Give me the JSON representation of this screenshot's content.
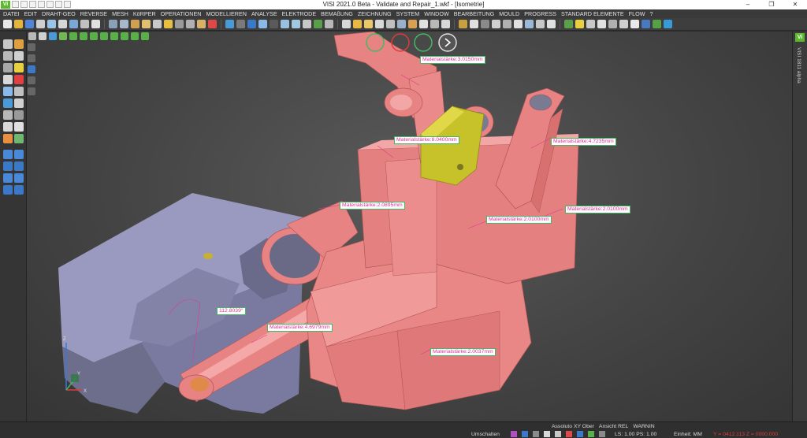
{
  "window": {
    "title": "VISI 2021.0 Beta - Validate and Repair_1.wkf - [Isometrie]",
    "logo_text": "Vi",
    "controls": [
      "–",
      "❐",
      "✕"
    ]
  },
  "menu": {
    "items": [
      "DATEI",
      "EDIT",
      "DRAHT-GEO",
      "REVERSE",
      "MESH",
      "KöRPER",
      "OPERATIONEN",
      "MODELLIEREN",
      "ANALYSE",
      "ELEKTRODE",
      "BEMAßUNG",
      "ZEICHNUNG",
      "SYSTEM",
      "WINDOW",
      "BEARBEITUNG",
      "MOULD",
      "PROGRESS",
      "STANDARD ELEMENTE",
      "FLOW",
      "?"
    ]
  },
  "right_panel": {
    "logo_text": "Vi",
    "vertical_label": "VISI 1811 alpha"
  },
  "viewport": {
    "view_name": "Isometrie",
    "annotations": [
      {
        "label": "Materialstärke:3.0150mm"
      },
      {
        "label": "Materialstärke:8.0400mm"
      },
      {
        "label": "Materialstärke:4.7235mm"
      },
      {
        "label": "Materialstärke:2.0895mm"
      },
      {
        "label": "Materialstärke:2.0100mm"
      },
      {
        "label": "Materialstärke:2.0100mm"
      },
      {
        "label": "112.8039°"
      },
      {
        "label": "Materialstärke:4.6979mm"
      },
      {
        "label": "Materialstärke:2.0037mm"
      }
    ],
    "axes": {
      "x": "X",
      "y": "Y",
      "z": "Z"
    }
  },
  "status": {
    "row1": [
      "Assoluto XY Ober",
      "Ansicht REL",
      "WARNIN"
    ],
    "umschalten": "Umschalten",
    "ls_ps": "LS: 1.00 PS: 1.00",
    "einheit": "Einheit: MM",
    "coords": "Y = 0412.113 Z = 0000.000"
  },
  "colors": {
    "part_pink": "#e88383",
    "part_yellow": "#c7c12a",
    "mould_blue": "#8c8cb0",
    "accent_green": "#5cb82c"
  }
}
